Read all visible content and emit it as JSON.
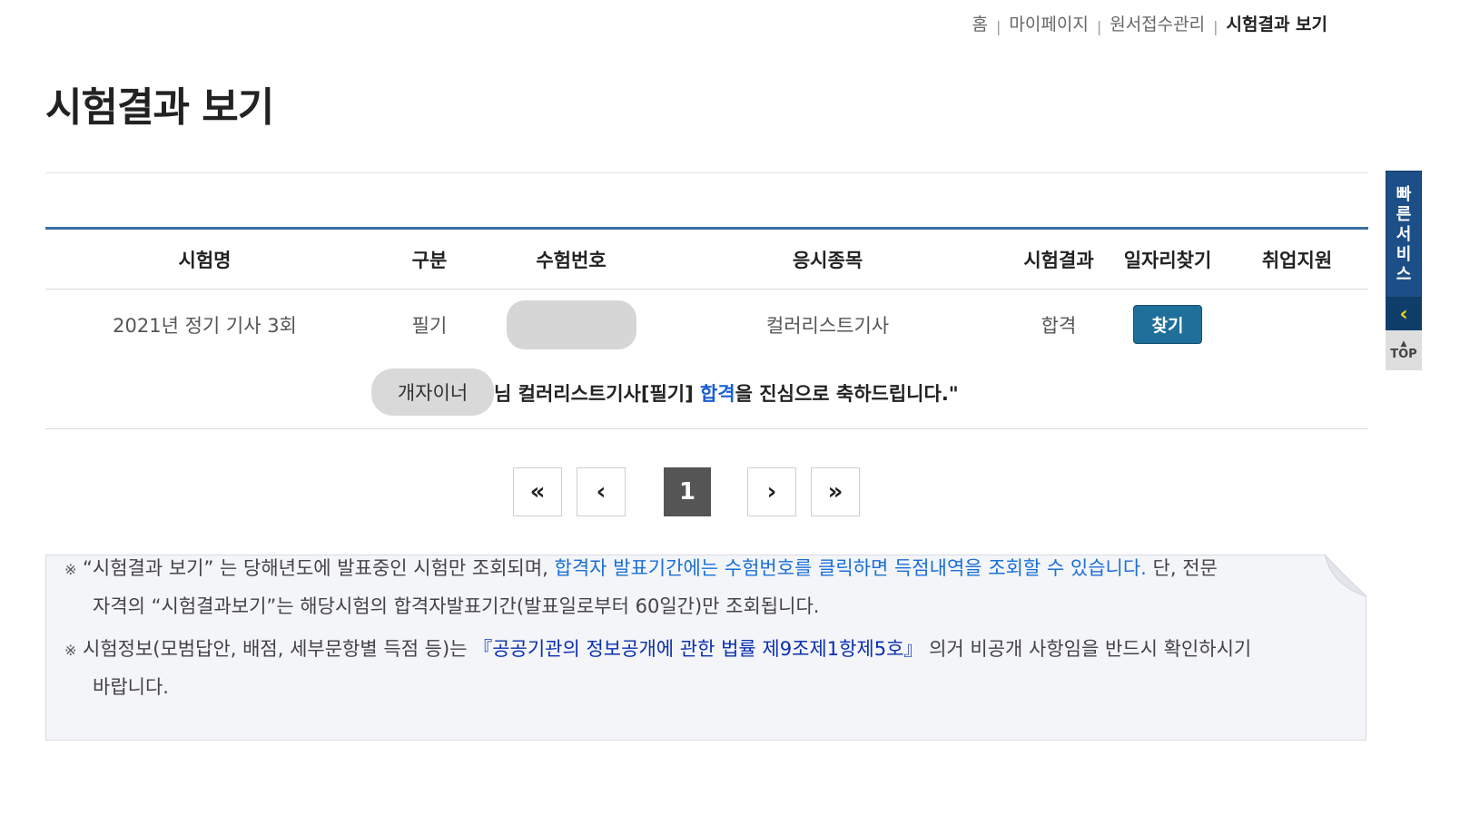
{
  "breadcrumb": [
    "홈",
    "마이페이지",
    "원서접수관리",
    "시험결과 보기"
  ],
  "page_title": "시험결과 보기",
  "table": {
    "headers": [
      "시험명",
      "구분",
      "수험번호",
      "응시종목",
      "시험결과",
      "일자리찾기",
      "취업지원"
    ],
    "row": {
      "exam_name": "2021년 정기 기사 3회",
      "type": "필기",
      "exam_number": "",
      "subject": "컬러리스트기사",
      "result": "합격",
      "job_button": "찾기",
      "support": ""
    }
  },
  "congrats": {
    "name": "개자이너",
    "prefix": "님 컬러리스트기사[필기] ",
    "result": "합격",
    "suffix": "을 진심으로 축하드립니다.\""
  },
  "pagination": {
    "first": "«",
    "prev": "‹",
    "current": "1",
    "next": "›",
    "last": "»"
  },
  "notice": {
    "mark": "※",
    "n1_a": "“시험결과 보기” 는 당해년도에 발표중인 시험만 조회되며, ",
    "n1_b": "합격자 발표기간에는 수험번호를 클릭하면 득점내역을 조회할 수 있습니다.",
    "n1_c": " 단, 전문",
    "n1_d": "자격의 “시험결과보기”는 해당시험의 합격자발표기간(발표일로부터 60일간)만 조회됩니다.",
    "n2_a": "시험정보(모범답안, 배점, 세부문항별 득점 등)는 ",
    "n2_b": "『공공기관의 정보공개에 관한 법률 제9조제1항제5호』",
    "n2_c": " 의거 비공개 사항임을 반드시 확인하시기",
    "n2_d": "바랍니다."
  },
  "quick_service": {
    "label_chars": [
      "빠",
      "른",
      "서",
      "비",
      "스"
    ],
    "toggle": "‹",
    "top_arrow": "▲",
    "top": "TOP"
  },
  "colors": {
    "table_top_border": "#3a6ea5",
    "button": "#1f6f9b",
    "link": "#1a6fd6",
    "law_link": "#0a2fb0",
    "quick_bar": "#1c4f87"
  }
}
